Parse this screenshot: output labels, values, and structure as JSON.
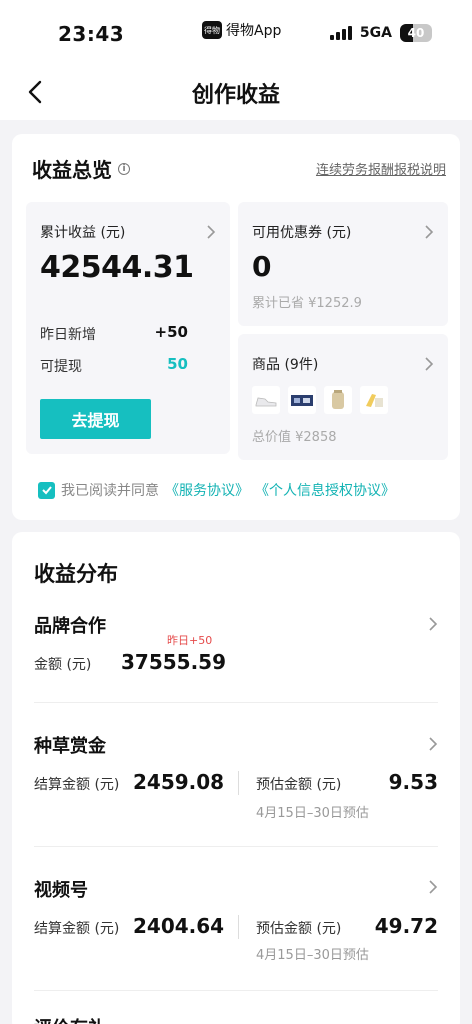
{
  "status_bar": {
    "time": "23:43",
    "app_name": "得物App",
    "app_logo_text": "得物",
    "network": "5GA",
    "battery": "40",
    "battery_level": 0.4
  },
  "nav": {
    "title": "创作收益"
  },
  "overview": {
    "title": "收益总览",
    "info_glyph": "i",
    "tax_link": "连续劳务报酬报税说明",
    "earnings": {
      "label": "累计收益 (元)",
      "value": "42544.31",
      "yesterday_label": "昨日新增",
      "yesterday_value": "+50",
      "withdrawable_label": "可提现",
      "withdrawable_value": "50",
      "withdraw_button": "去提现"
    },
    "coupon": {
      "label": "可用优惠券 (元)",
      "value": "0",
      "saved": "累计已省 ¥1252.9"
    },
    "goods": {
      "label": "商品 (9件)",
      "total": "总价值 ¥2858"
    },
    "agreement": {
      "prefix": "我已阅读并同意",
      "link1": "《服务协议》",
      "link2": "《个人信息授权协议》"
    }
  },
  "distribution": {
    "title": "收益分布",
    "brand": {
      "title": "品牌合作",
      "amount_label": "金额 (元)",
      "amount": "37555.59",
      "tag": "昨日+50"
    },
    "grass": {
      "title": "种草赏金",
      "settled_label": "结算金额 (元)",
      "settled": "2459.08",
      "estimate_label": "预估金额 (元)",
      "estimate": "9.53",
      "note": "4月15日–30日预估"
    },
    "video": {
      "title": "视频号",
      "settled_label": "结算金额 (元)",
      "settled": "2404.64",
      "estimate_label": "预估金额 (元)",
      "estimate": "49.72",
      "note": "4月15日–30日预估"
    },
    "next": {
      "title": "评价有礼"
    }
  },
  "colors": {
    "accent": "#16bfc0",
    "link": "#14b3b4",
    "alert": "#e54b4b"
  },
  "icons": [
    "back-arrow-icon",
    "info-icon",
    "chevron-right-icon",
    "checkmark-icon",
    "signal-icon",
    "battery-icon"
  ]
}
